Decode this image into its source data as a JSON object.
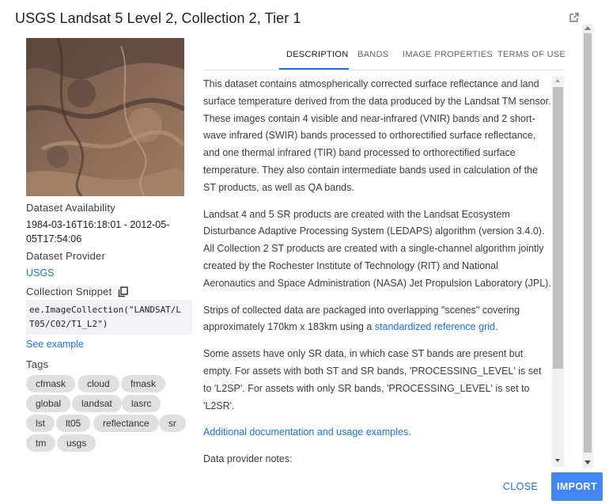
{
  "dialog": {
    "title": "USGS Landsat 5 Level 2, Collection 2, Tier 1",
    "open_icon": "open-in-new-icon"
  },
  "metadata": {
    "availability_label": "Dataset Availability",
    "availability_line1": "1984-03-16T16:18:01 - 2012-05-",
    "availability_line2": "05T17:54:06",
    "provider_label": "Dataset Provider",
    "provider_link": "USGS",
    "snippet_label": "Collection Snippet",
    "snippet_icon": "copy-icon",
    "snippet_line1": "ee.ImageCollection(\"LANDSAT/L",
    "snippet_line2": "T05/C02/T1_L2\")",
    "see_example": "See example",
    "tags_label": "Tags",
    "tags": [
      "cfmask",
      "cloud",
      "fmask",
      "global",
      "landsat",
      "lasrc",
      "lst",
      "lt05",
      "reflectance",
      "sr",
      "tm",
      "usgs"
    ]
  },
  "tabs": [
    {
      "label": "DESCRIPTION",
      "active": true
    },
    {
      "label": "BANDS",
      "active": false
    },
    {
      "label": "IMAGE PROPERTIES",
      "active": false
    },
    {
      "label": "TERMS OF USE",
      "active": false
    }
  ],
  "description": {
    "p1": "This dataset contains atmospherically corrected surface reflectance and land surface temperature derived from the data produced by the Landsat TM sensor. These images contain 4 visible and near-infrared (VNIR) bands and 2 short-wave infrared (SWIR) bands processed to orthorectified surface reflectance, and one thermal infrared (TIR) band processed to orthorectified surface temperature. They also contain intermediate bands used in calculation of the ST products, as well as QA bands.",
    "p2": "Landsat 4 and 5 SR products are created with the Landsat Ecosystem Disturbance Adaptive Processing System (LEDAPS) algorithm (version 3.4.0). All Collection 2 ST products are created with a single-channel algorithm jointly created by the Rochester Institute of Technology (RIT) and National Aeronautics and Space Administration (NASA) Jet Propulsion Laboratory (JPL).",
    "p3_prefix": "Strips of collected data are packaged into overlapping \"scenes\" covering approximately 170km x 183km using a ",
    "p3_link": "standardized reference grid",
    "p3_suffix": ".",
    "p4": "Some assets have only SR data, in which case ST bands are present but empty. For assets with both ST and SR bands, 'PROCESSING_LEVEL' is set to 'L2SP'. For assets with only SR bands, 'PROCESSING_LEVEL' is set to 'L2SR'.",
    "p5_link": "Additional documentation and usage examples.",
    "p6": "Data provider notes:"
  },
  "footer": {
    "close_label": "CLOSE",
    "import_label": "IMPORT"
  },
  "colors": {
    "accent": "#1a73e8",
    "import_bg": "#4285f4",
    "tag_bg": "#e0e0e0"
  }
}
